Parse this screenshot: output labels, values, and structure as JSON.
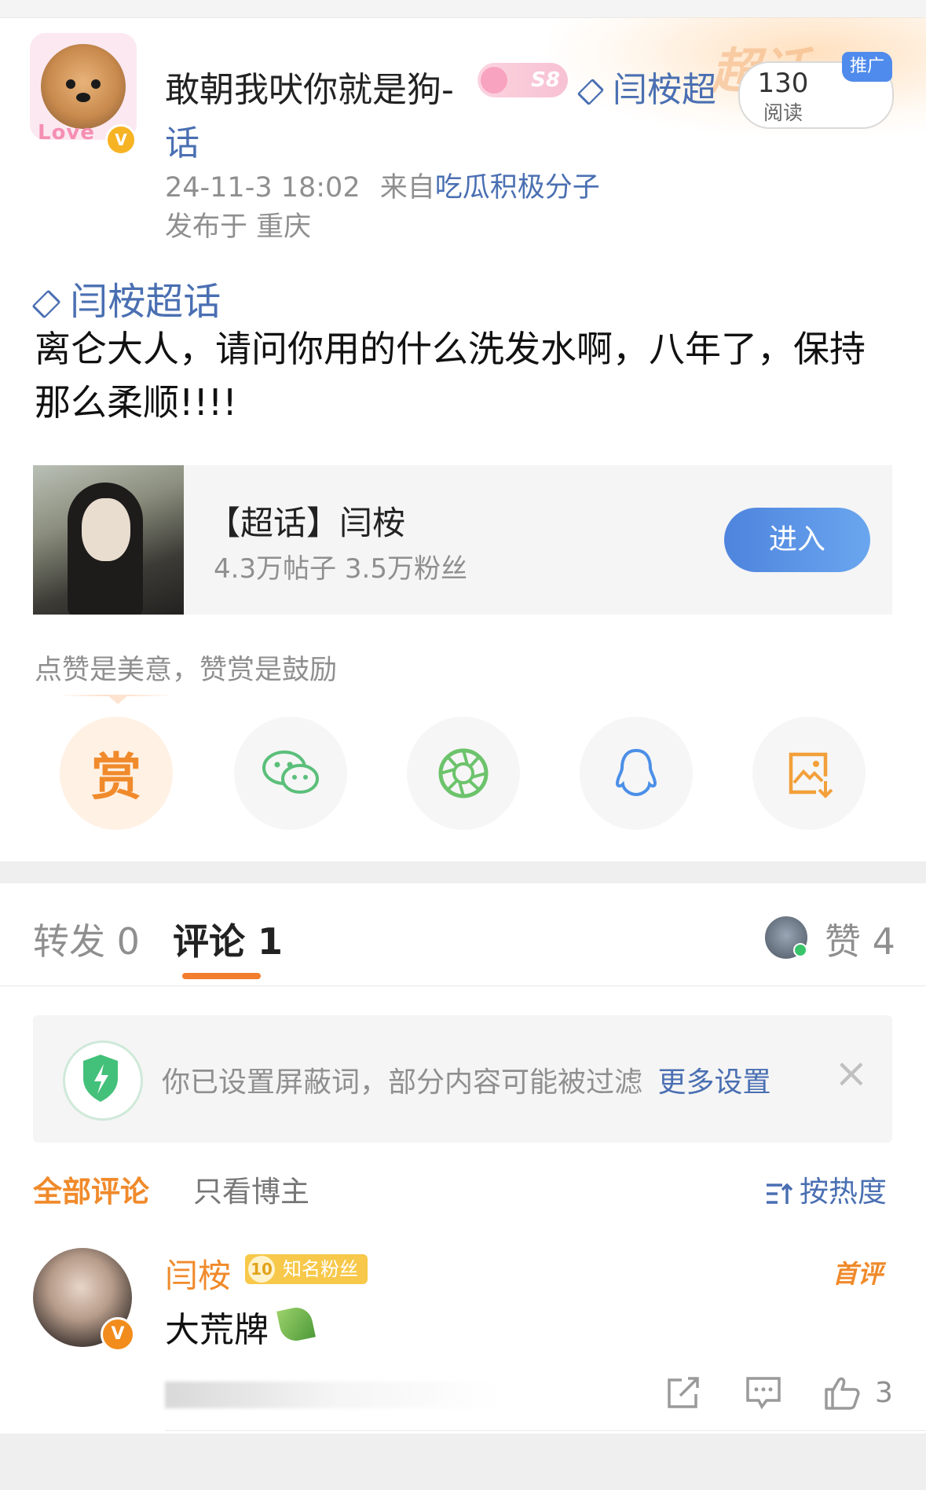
{
  "post": {
    "username": "敢朝我吠你就是狗-",
    "level_badge": "S8",
    "avatar_text": "Love",
    "verified_mark": "V",
    "topic_line": "闫桉超",
    "topic_line_cont": "话",
    "timestamp": "24-11-3 18:02",
    "from_prefix": "来自",
    "from_source": "吃瓜积极分子",
    "location": "发布于 重庆",
    "read_count": "130",
    "read_label": "阅读",
    "ad_tag": "推广",
    "deco_text": "超话",
    "topic_tag": "闫桉超话",
    "text": "离仑大人，请问你用的什么洗发水啊，八年了，保持那么柔顺!!!!"
  },
  "card": {
    "title": "【超话】闫桉",
    "subtitle": "4.3万帖子 3.5万粉丝",
    "enter_label": "进入"
  },
  "share": {
    "tip": "点赞是美意，赞赏是鼓励",
    "reward_char": "赏",
    "items": [
      "reward-icon",
      "wechat-icon",
      "moments-icon",
      "qq-icon",
      "save-image-icon"
    ]
  },
  "tabs": {
    "forward_label": "转发 0",
    "comment_label": "评论 1",
    "like_label": "赞 4"
  },
  "filter_notice": {
    "text": "你已设置屏蔽词，部分内容可能被过滤",
    "link": "更多设置",
    "close": "×"
  },
  "comment_filters": {
    "all": "全部评论",
    "owner_only": "只看博主",
    "sort": "按热度"
  },
  "comment": {
    "name": "闫桉",
    "fan_level": "10",
    "fan_badge": "知名粉丝",
    "first_tag": "首评",
    "text": "大荒牌",
    "verified_mark": "V",
    "like_count": "3"
  },
  "colors": {
    "accent_orange": "#f08a2b",
    "link_blue": "#4a6fb2",
    "button_blue": "#4e84dd"
  }
}
